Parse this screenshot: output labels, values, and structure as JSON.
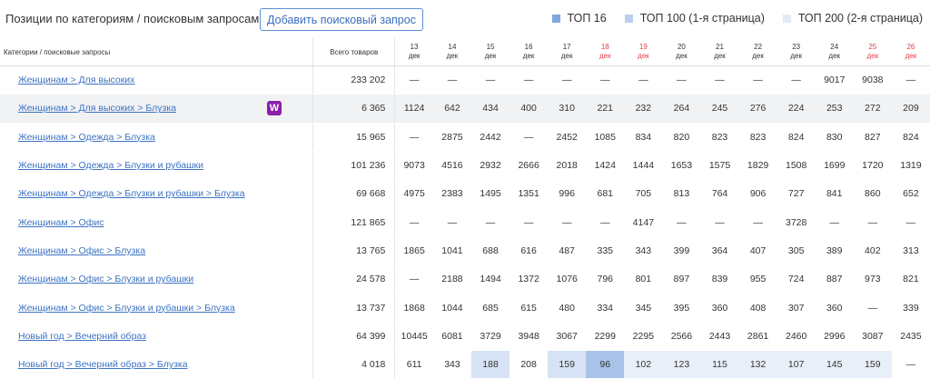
{
  "header": {
    "title": "Позиции по категориям / поисковым запросам",
    "add_button": "Добавить поисковый запрос",
    "legend": [
      {
        "label": "ТОП 16",
        "color": "#7fa7d9"
      },
      {
        "label": "ТОП 100 (1-я страница)",
        "color": "#bcd0ec"
      },
      {
        "label": "ТОП 200 (2-я страница)",
        "color": "#e2eaf6"
      }
    ]
  },
  "columns": {
    "category": "Категории / поисковые запросы",
    "total": "Всего товаров",
    "days": [
      {
        "d": "13",
        "m": "дек",
        "weekend": false
      },
      {
        "d": "14",
        "m": "дек",
        "weekend": false
      },
      {
        "d": "15",
        "m": "дек",
        "weekend": false
      },
      {
        "d": "16",
        "m": "дек",
        "weekend": false
      },
      {
        "d": "17",
        "m": "дек",
        "weekend": false
      },
      {
        "d": "18",
        "m": "дек",
        "weekend": true
      },
      {
        "d": "19",
        "m": "дек",
        "weekend": true
      },
      {
        "d": "20",
        "m": "дек",
        "weekend": false
      },
      {
        "d": "21",
        "m": "дек",
        "weekend": false
      },
      {
        "d": "22",
        "m": "дек",
        "weekend": false
      },
      {
        "d": "23",
        "m": "дек",
        "weekend": false
      },
      {
        "d": "24",
        "m": "дек",
        "weekend": false
      },
      {
        "d": "25",
        "m": "дек",
        "weekend": true
      },
      {
        "d": "26",
        "m": "дек",
        "weekend": true
      }
    ]
  },
  "rows": [
    {
      "cat": "Женщинам > Для высоких",
      "total": "233 202",
      "v": [
        "—",
        "—",
        "—",
        "—",
        "—",
        "—",
        "—",
        "—",
        "—",
        "—",
        "—",
        "9017",
        "9038",
        "—"
      ]
    },
    {
      "cat": "Женщинам > Для высоких > Блузка",
      "total": "6 365",
      "highlight": true,
      "badge": "W",
      "v": [
        "1124",
        "642",
        "434",
        "400",
        "310",
        "221",
        "232",
        "264",
        "245",
        "276",
        "224",
        "253",
        "272",
        "209"
      ]
    },
    {
      "cat": "Женщинам > Одежда > Блузка",
      "total": "15 965",
      "v": [
        "—",
        "2875",
        "2442",
        "—",
        "2452",
        "1085",
        "834",
        "820",
        "823",
        "823",
        "824",
        "830",
        "827",
        "824"
      ]
    },
    {
      "cat": "Женщинам > Одежда > Блузки и рубашки",
      "total": "101 236",
      "v": [
        "9073",
        "4516",
        "2932",
        "2666",
        "2018",
        "1424",
        "1444",
        "1653",
        "1575",
        "1829",
        "1508",
        "1699",
        "1720",
        "1319"
      ]
    },
    {
      "cat": "Женщинам > Одежда > Блузки и рубашки > Блузка",
      "total": "69 668",
      "v": [
        "4975",
        "2383",
        "1495",
        "1351",
        "996",
        "681",
        "705",
        "813",
        "764",
        "906",
        "727",
        "841",
        "860",
        "652"
      ]
    },
    {
      "cat": "Женщинам > Офис",
      "total": "121 865",
      "v": [
        "—",
        "—",
        "—",
        "—",
        "—",
        "—",
        "4147",
        "—",
        "—",
        "—",
        "3728",
        "—",
        "—",
        "—"
      ]
    },
    {
      "cat": "Женщинам > Офис > Блузка",
      "total": "13 765",
      "v": [
        "1865",
        "1041",
        "688",
        "616",
        "487",
        "335",
        "343",
        "399",
        "364",
        "407",
        "305",
        "389",
        "402",
        "313"
      ]
    },
    {
      "cat": "Женщинам > Офис > Блузки и рубашки",
      "total": "24 578",
      "v": [
        "—",
        "2188",
        "1494",
        "1372",
        "1076",
        "796",
        "801",
        "897",
        "839",
        "955",
        "724",
        "887",
        "973",
        "821"
      ]
    },
    {
      "cat": "Женщинам > Офис > Блузки и рубашки > Блузка",
      "total": "13 737",
      "v": [
        "1868",
        "1044",
        "685",
        "615",
        "480",
        "334",
        "345",
        "395",
        "360",
        "408",
        "307",
        "360",
        "—",
        "339"
      ]
    },
    {
      "cat": "Новый год > Вечерний образ",
      "total": "64 399",
      "v": [
        "10445",
        "6081",
        "3729",
        "3948",
        "3067",
        "2299",
        "2295",
        "2566",
        "2443",
        "2861",
        "2460",
        "2996",
        "3087",
        "2435"
      ]
    },
    {
      "cat": "Новый год > Вечерний образ > Блузка",
      "total": "4 018",
      "v": [
        "611",
        "343",
        "188",
        "208",
        "159",
        "96",
        "102",
        "123",
        "115",
        "132",
        "107",
        "145",
        "159",
        "—"
      ],
      "tiers": [
        "",
        "",
        "t2",
        "",
        "t2",
        "t1",
        "t3",
        "t3",
        "t3",
        "t3",
        "t3",
        "t3",
        "t3",
        ""
      ]
    }
  ]
}
